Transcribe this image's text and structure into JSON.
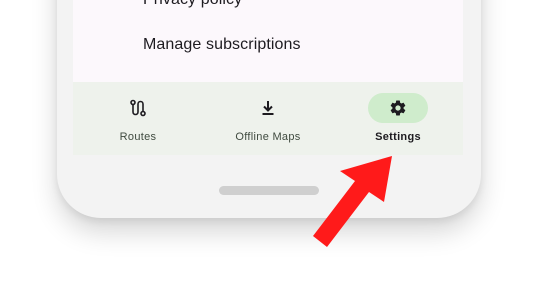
{
  "settings_list": {
    "partial_item_label": "Privacy policy",
    "manage_subscriptions_label": "Manage subscriptions"
  },
  "bottom_nav": {
    "items": [
      {
        "label": "Routes",
        "icon": "route-icon",
        "selected": false
      },
      {
        "label": "Offline Maps",
        "icon": "download-icon",
        "selected": false
      },
      {
        "label": "Settings",
        "icon": "gear-icon",
        "selected": true
      }
    ]
  },
  "colors": {
    "nav_background": "#eef2ec",
    "active_indicator": "#cfeccc",
    "arrow": "#ff1a1a"
  }
}
